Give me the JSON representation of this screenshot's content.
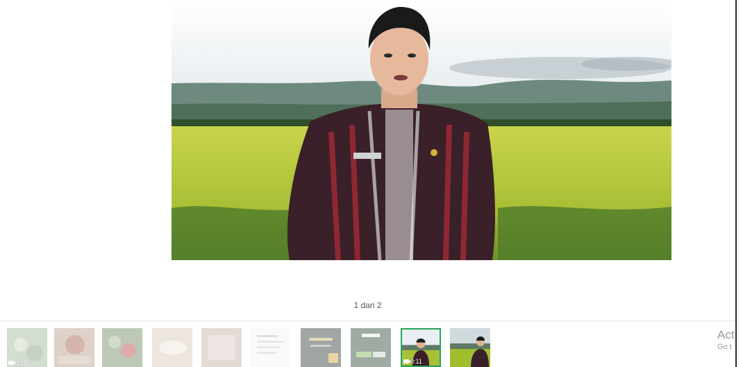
{
  "pager": {
    "text": "1 dari 2"
  },
  "thumbnails": [
    {
      "duration": "0:10",
      "selected": false
    },
    {
      "selected": false
    },
    {
      "selected": false
    },
    {
      "selected": false
    },
    {
      "selected": false
    },
    {
      "selected": false
    },
    {
      "selected": false
    },
    {
      "selected": false
    },
    {
      "duration": "0:11",
      "selected": true
    },
    {
      "selected": false
    }
  ],
  "watermark": {
    "title": "Act",
    "subtitle": "Go t"
  },
  "colors": {
    "selected_border": "#22a35a",
    "field_green": "#a8c43a",
    "sky": "#e9eef1"
  }
}
